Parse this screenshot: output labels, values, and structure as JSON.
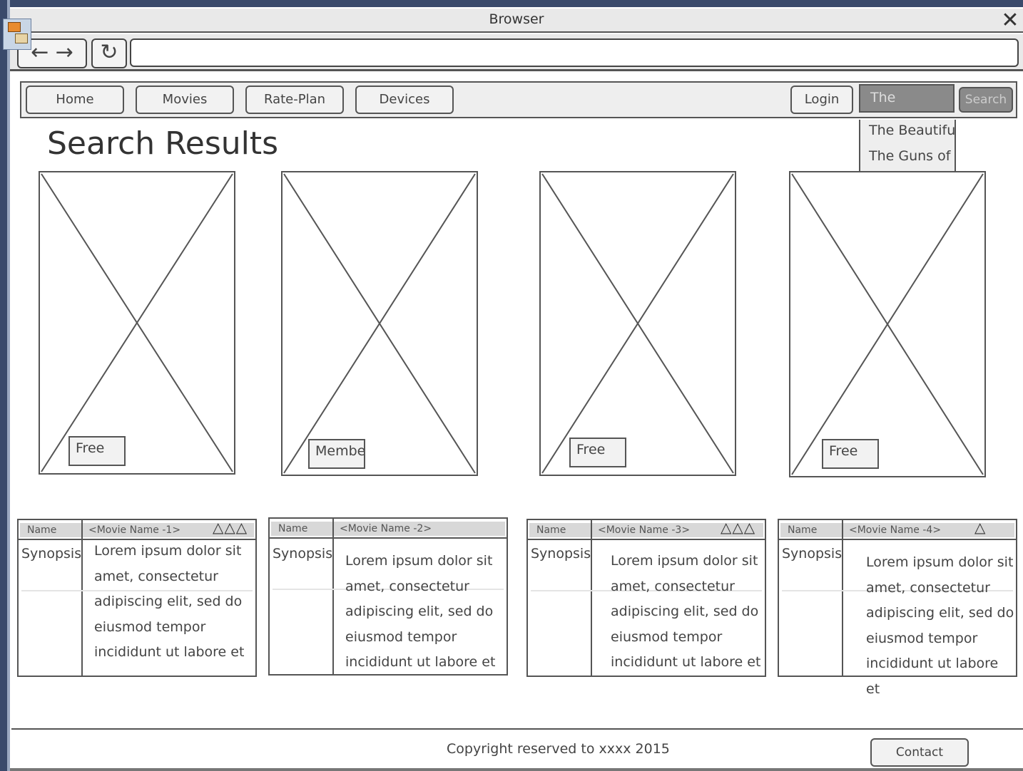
{
  "window": {
    "title": "Browser"
  },
  "toolbar": {
    "url": ""
  },
  "nav": {
    "tabs": [
      {
        "label": "Home"
      },
      {
        "label": "Movies"
      },
      {
        "label": "Rate-Plan"
      },
      {
        "label": "Devices"
      }
    ],
    "login_label": "Login",
    "search_value": "The",
    "search_label": "Search",
    "suggestions": [
      "The Beautifu",
      "The Guns of"
    ]
  },
  "page_title": "Search Results",
  "posters": [
    {
      "badge": "Free"
    },
    {
      "badge": "Member"
    },
    {
      "badge": "Free"
    },
    {
      "badge": "Free"
    }
  ],
  "movies": [
    {
      "name_label": "Name",
      "name": "<Movie Name -1>",
      "rating": 3,
      "synopsis_label": "Synopsis",
      "synopsis": "Lorem ipsum dolor sit amet, consectetur adipiscing elit, sed do eiusmod tempor incididunt ut labore et"
    },
    {
      "name_label": "Name",
      "name": "<Movie Name -2>",
      "rating": 0,
      "synopsis_label": "Synopsis",
      "synopsis": "Lorem ipsum dolor sit amet, consectetur adipiscing elit, sed do eiusmod tempor incididunt ut labore et"
    },
    {
      "name_label": "Name",
      "name": "<Movie Name -3>",
      "rating": 3,
      "synopsis_label": "Synopsis",
      "synopsis": "Lorem ipsum dolor sit amet, consectetur adipiscing elit, sed do eiusmod tempor incididunt ut labore et"
    },
    {
      "name_label": "Name",
      "name": "<Movie Name -4>",
      "rating": 1,
      "synopsis_label": "Synopsis",
      "synopsis": "Lorem ipsum dolor sit amet, consectetur adipiscing elit, sed do eiusmod tempor incididunt ut labore et"
    }
  ],
  "footer": {
    "copyright": "Copyright reserved to xxxx 2015",
    "contact_label": "Contact"
  }
}
